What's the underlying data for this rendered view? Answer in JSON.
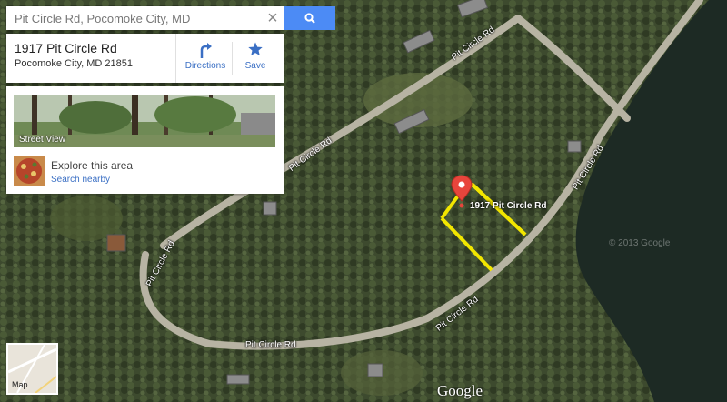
{
  "search": {
    "value": "Pit Circle Rd, Pocomoke City, MD",
    "clear_icon": "close-icon",
    "button_icon": "search-icon",
    "accent": "#4c8bf5"
  },
  "place": {
    "line1": "1917 Pit Circle Rd",
    "line2": "Pocomoke City, MD 21851",
    "directions_label": "Directions",
    "save_label": "Save",
    "action_color": "#3a6fc4"
  },
  "panel": {
    "street_view_label": "Street View",
    "explore_title": "Explore this area",
    "search_nearby": "Search nearby"
  },
  "roads": [
    "Pit Circle Rd",
    "Pit Circle Rd",
    "Pit Circle Rd",
    "Pit Circle Rd",
    "Pit Circle Rd"
  ],
  "pin": {
    "label": "1917 Pit Circle Rd",
    "color": "#e8453c",
    "outline_color": "#f2e600"
  },
  "minimap": {
    "label": "Map"
  },
  "attribution": {
    "brand": "Google",
    "watermark": "© 2013 Google"
  }
}
